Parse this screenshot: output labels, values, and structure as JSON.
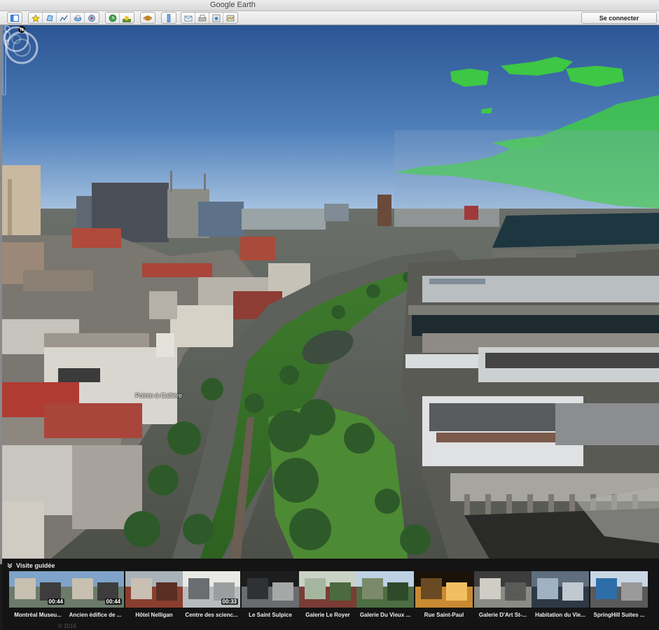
{
  "window": {
    "title": "Google Earth"
  },
  "toolbar": {
    "signin_label": "Se connecter",
    "icons": [
      "sidebar-toggle-icon",
      "placemark-icon",
      "polygon-icon",
      "path-icon",
      "image-overlay-icon",
      "record-tour-icon",
      "historical-imagery-icon",
      "sun-icon",
      "planets-icon",
      "ruler-icon",
      "email-icon",
      "print-icon",
      "save-image-icon",
      "maps-icon"
    ]
  },
  "view": {
    "place_label": "Pointe-à-Callière",
    "compass_north": "N"
  },
  "tour": {
    "header": "Visite guidée",
    "items": [
      {
        "caption": "Montréal Museu...",
        "duration": "00:44",
        "theme": "museum"
      },
      {
        "caption": "Ancien édifice de ...",
        "duration": "00:44",
        "theme": "museum"
      },
      {
        "caption": "Hôtel Nelligan",
        "duration": "",
        "theme": "brick"
      },
      {
        "caption": "Centre des scienc...",
        "duration": "00:33",
        "theme": "science"
      },
      {
        "caption": "Le Saint Sulpice",
        "duration": "",
        "theme": "street"
      },
      {
        "caption": "Galerie Le Royer",
        "duration": "",
        "theme": "garden"
      },
      {
        "caption": "Galerie Du Vieux ...",
        "duration": "",
        "theme": "park"
      },
      {
        "caption": "Rue Saint-Paul",
        "duration": "",
        "theme": "night"
      },
      {
        "caption": "Galerie D'Art St-...",
        "duration": "",
        "theme": "gallery"
      },
      {
        "caption": "Habitation du Vie...",
        "duration": "",
        "theme": "street2"
      },
      {
        "caption": "SpringHill Suites ...",
        "duration": "",
        "theme": "hotel"
      }
    ],
    "footer": "© 2016"
  },
  "colors": {
    "sky_top": "#2f5797",
    "sky_horizon": "#aac6e4",
    "weather_overlay": "#3dd43d",
    "water": "#1e3640"
  }
}
